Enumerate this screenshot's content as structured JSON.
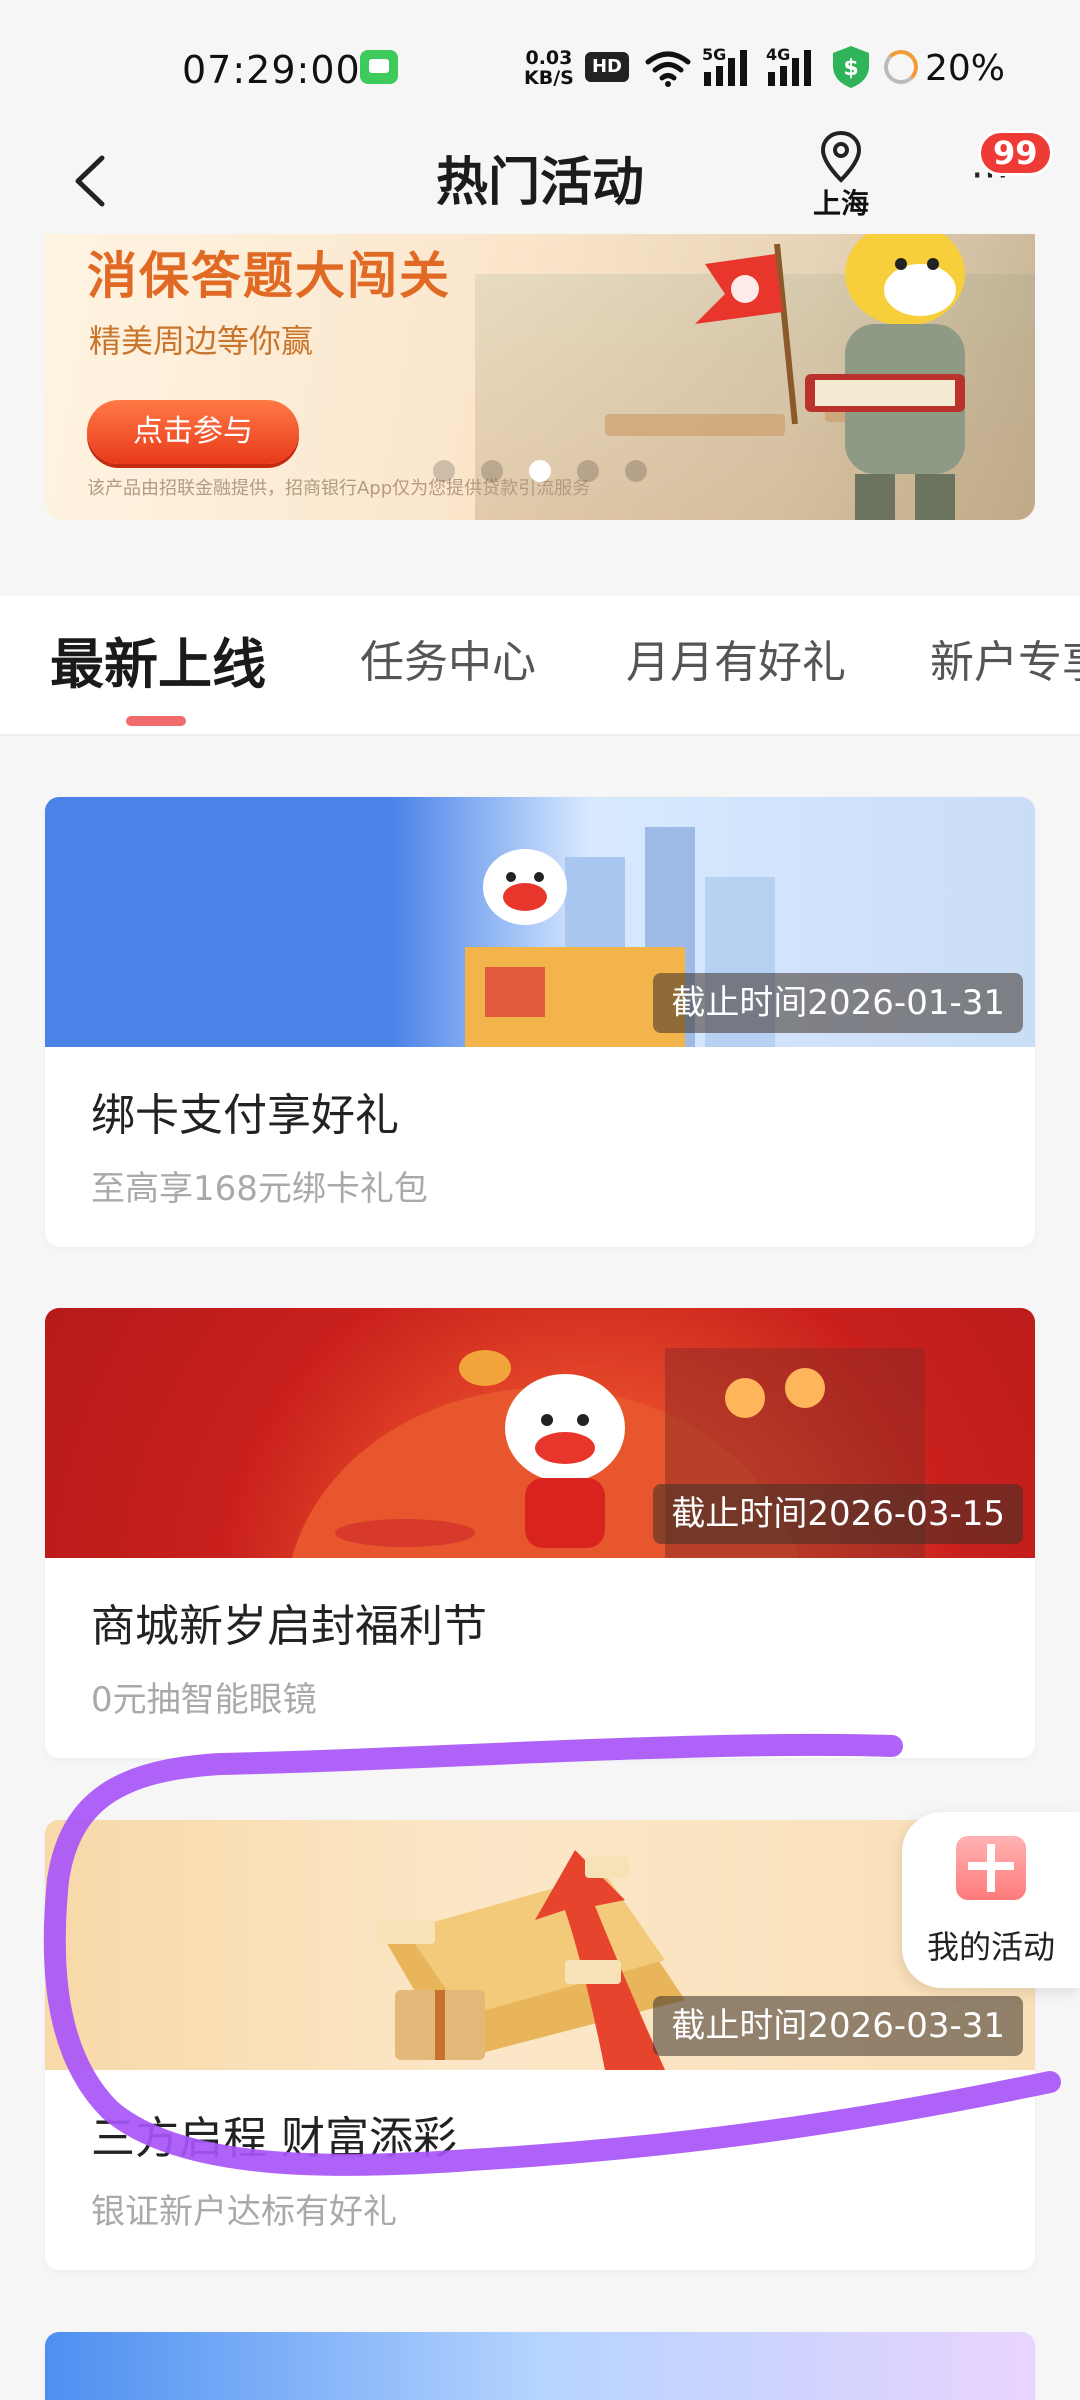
{
  "status_bar": {
    "time": "07:29:00",
    "net_speed_value": "0.03",
    "net_speed_unit": "KB/S",
    "hd_label": "HD",
    "signal_5g": "5G",
    "signal_4g": "4G",
    "battery": "20%"
  },
  "header": {
    "title": "热门活动",
    "location": "上海",
    "notification_count": "99"
  },
  "banner": {
    "title": "消保答题大闯关",
    "subtitle": "精美周边等你赢",
    "button": "点击参与",
    "disclaimer": "该产品由招联金融提供，招商银行App仅为您提供贷款引流服务",
    "slides_total": 5,
    "active_slide": 3
  },
  "tabs": [
    {
      "label": "最新上线",
      "active": true
    },
    {
      "label": "任务中心",
      "active": false
    },
    {
      "label": "月月有好礼",
      "active": false
    },
    {
      "label": "新户专享",
      "active": false
    }
  ],
  "cards": [
    {
      "title": "绑卡支付享好礼",
      "subtitle": "至高享168元绑卡礼包",
      "deadline": "截止时间2026-01-31"
    },
    {
      "title": "商城新岁启封福利节",
      "subtitle": "0元抽智能眼镜",
      "deadline": "截止时间2026-03-15"
    },
    {
      "title": "三方启程 财富添彩",
      "subtitle": "银证新户达标有好礼",
      "deadline": "截止时间2026-03-31"
    }
  ],
  "floating": {
    "label": "我的活动"
  },
  "colors": {
    "accent_red": "#ef3b36",
    "tab_indicator": "#f06b6b",
    "banner_title": "#e06a24",
    "annotation_stroke": "#a855f7"
  }
}
